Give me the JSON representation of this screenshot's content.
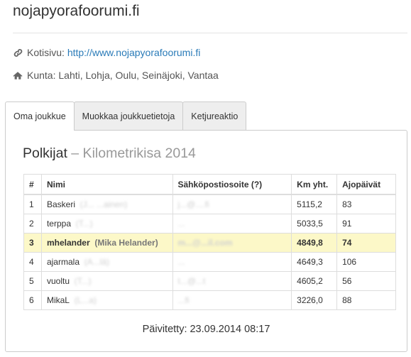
{
  "site": {
    "title": "nojapyorafoorumi.fi",
    "homepage_label": "Kotisivu:",
    "homepage_url": "http://www.nojapyorafoorumi.fi",
    "municipality_label": "Kunta:",
    "municipalities": "Lahti, Lohja, Oulu, Seinäjoki, Vantaa"
  },
  "tabs": [
    {
      "label": "Oma joukkue",
      "active": true
    },
    {
      "label": "Muokkaa joukkuetietoja",
      "active": false
    },
    {
      "label": "Ketjureaktio",
      "active": false
    }
  ],
  "panel": {
    "title": "Polkijat",
    "subtitle": "– Kilometrikisa 2014",
    "columns": [
      "#",
      "Nimi",
      "Sähköpostiosoite (?)",
      "Km yht.",
      "Ajopäivät"
    ],
    "rows": [
      {
        "rank": "1",
        "nick": "Baskeri",
        "realname": "(J... ...ainen)",
        "email": "j...@....fi",
        "km": "5115,2",
        "days": "83",
        "highlight": false
      },
      {
        "rank": "2",
        "nick": "terppa",
        "realname": "(T...)",
        "email": "...",
        "km": "5033,5",
        "days": "91",
        "highlight": false
      },
      {
        "rank": "3",
        "nick": "mhelander",
        "realname": "(Mika Helander)",
        "email": "m...@...il.com",
        "km": "4849,8",
        "days": "74",
        "highlight": true
      },
      {
        "rank": "4",
        "nick": "ajarmala",
        "realname": "(A...lä)",
        "email": "...",
        "km": "4649,3",
        "days": "106",
        "highlight": false
      },
      {
        "rank": "5",
        "nick": "vuoltu",
        "realname": "(T...)",
        "email": "t...@...t",
        "km": "4605,2",
        "days": "56",
        "highlight": false
      },
      {
        "rank": "6",
        "nick": "MikaL",
        "realname": "(L...a)",
        "email": "...fi",
        "km": "3226,0",
        "days": "88",
        "highlight": false
      }
    ],
    "updated": "Päivitetty: 23.09.2014 08:17"
  },
  "icons": {
    "homepage": "link-icon",
    "municipality": "home-icon"
  }
}
